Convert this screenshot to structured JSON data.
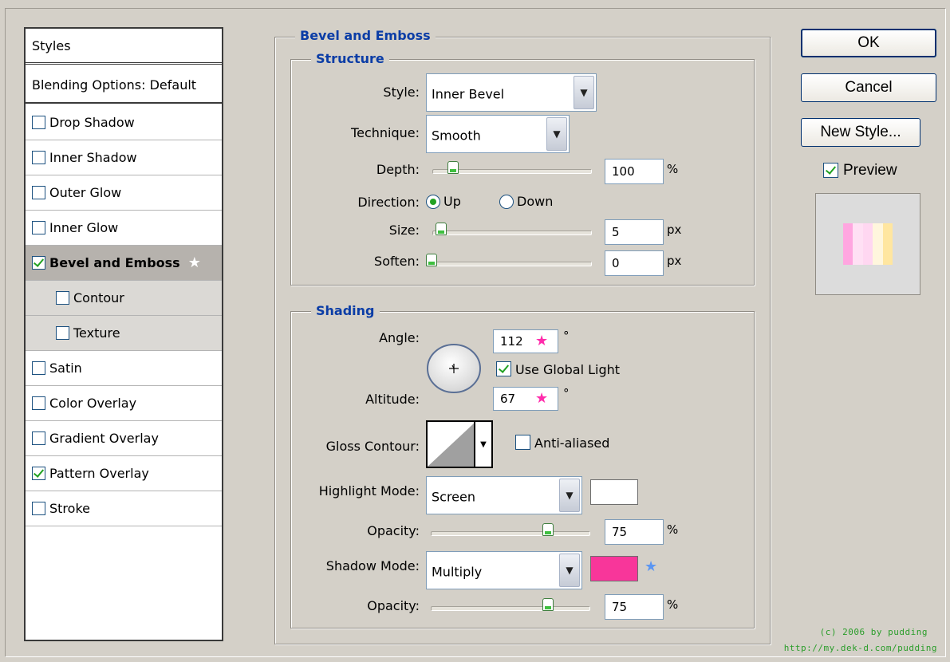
{
  "styles_panel": {
    "header": "Styles",
    "blending": "Blending Options: Default",
    "items": [
      {
        "label": "Drop Shadow",
        "checked": false
      },
      {
        "label": "Inner Shadow",
        "checked": false
      },
      {
        "label": "Outer Glow",
        "checked": false
      },
      {
        "label": "Inner Glow",
        "checked": false
      },
      {
        "label": "Bevel and Emboss",
        "checked": true,
        "selected": true
      },
      {
        "label": "Contour",
        "checked": false,
        "sub": true
      },
      {
        "label": "Texture",
        "checked": false,
        "sub": true
      },
      {
        "label": "Satin",
        "checked": false
      },
      {
        "label": "Color Overlay",
        "checked": false
      },
      {
        "label": "Gradient Overlay",
        "checked": false
      },
      {
        "label": "Pattern Overlay",
        "checked": true
      },
      {
        "label": "Stroke",
        "checked": false
      }
    ]
  },
  "bevel": {
    "title": "Bevel and Emboss",
    "structure": {
      "title": "Structure",
      "style_label": "Style:",
      "style_value": "Inner Bevel",
      "technique_label": "Technique:",
      "technique_value": "Smooth",
      "depth_label": "Depth:",
      "depth_value": "100",
      "depth_unit": "%",
      "depth_fraction": 0.1,
      "direction_label": "Direction:",
      "direction_up": "Up",
      "direction_down": "Down",
      "size_label": "Size:",
      "size_value": "5",
      "size_unit": "px",
      "size_fraction": 0.02,
      "soften_label": "Soften:",
      "soften_value": "0",
      "soften_unit": "px",
      "soften_fraction": 0.0
    },
    "shading": {
      "title": "Shading",
      "angle_label": "Angle:",
      "angle_value": "112",
      "degree": "°",
      "use_global_light": "Use Global Light",
      "altitude_label": "Altitude:",
      "altitude_value": "67",
      "gloss_label": "Gloss Contour:",
      "anti_aliased": "Anti-aliased",
      "highlight_label": "Highlight Mode:",
      "highlight_value": "Screen",
      "highlight_color": "#ffffff",
      "opacity_label": "Opacity:",
      "highlight_opacity": "75",
      "highlight_opacity_fraction": 0.75,
      "shadow_label": "Shadow Mode:",
      "shadow_value": "Multiply",
      "shadow_color": "#f8369a",
      "shadow_opacity": "75",
      "shadow_opacity_fraction": 0.75,
      "percent": "%"
    }
  },
  "buttons": {
    "ok": "OK",
    "cancel": "Cancel",
    "new_style": "New Style...",
    "preview": "Preview"
  },
  "credits": {
    "line1": "(c) 2006 by pudding",
    "line2": "http://my.dek-d.com/pudding"
  }
}
